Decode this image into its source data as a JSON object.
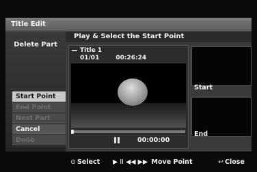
{
  "window": {
    "title": "Title Edit"
  },
  "left_panel": {
    "heading": "Delete Part",
    "menu": [
      {
        "label": "Start Point",
        "state": "active"
      },
      {
        "label": "End Point",
        "state": "disabled"
      },
      {
        "label": "Next Part",
        "state": "disabled"
      },
      {
        "label": "Cancel",
        "state": "enabled"
      },
      {
        "label": "Done",
        "state": "disabled"
      }
    ]
  },
  "main": {
    "heading": "Play & Select the Start Point",
    "video": {
      "title": "Title 1",
      "counter": "01/01",
      "duration": "00:26:24",
      "position": "00:00:00",
      "progress": 0.0,
      "state_icon": "pause-icon"
    },
    "start_thumb_label": "Start",
    "end_thumb_label": "End"
  },
  "footer": {
    "select_icon": "⊙",
    "select_label": "Select",
    "transport_icons": "▶ II ◀◀ ▶▶",
    "move_label": "Move Point",
    "close_icon": "↩",
    "close_label": "Close"
  },
  "colors": {
    "menu_active_bg": "#c9c9c9",
    "menu_disabled_text": "#6e6e6e",
    "panel_bg": "#3a3a3a"
  }
}
